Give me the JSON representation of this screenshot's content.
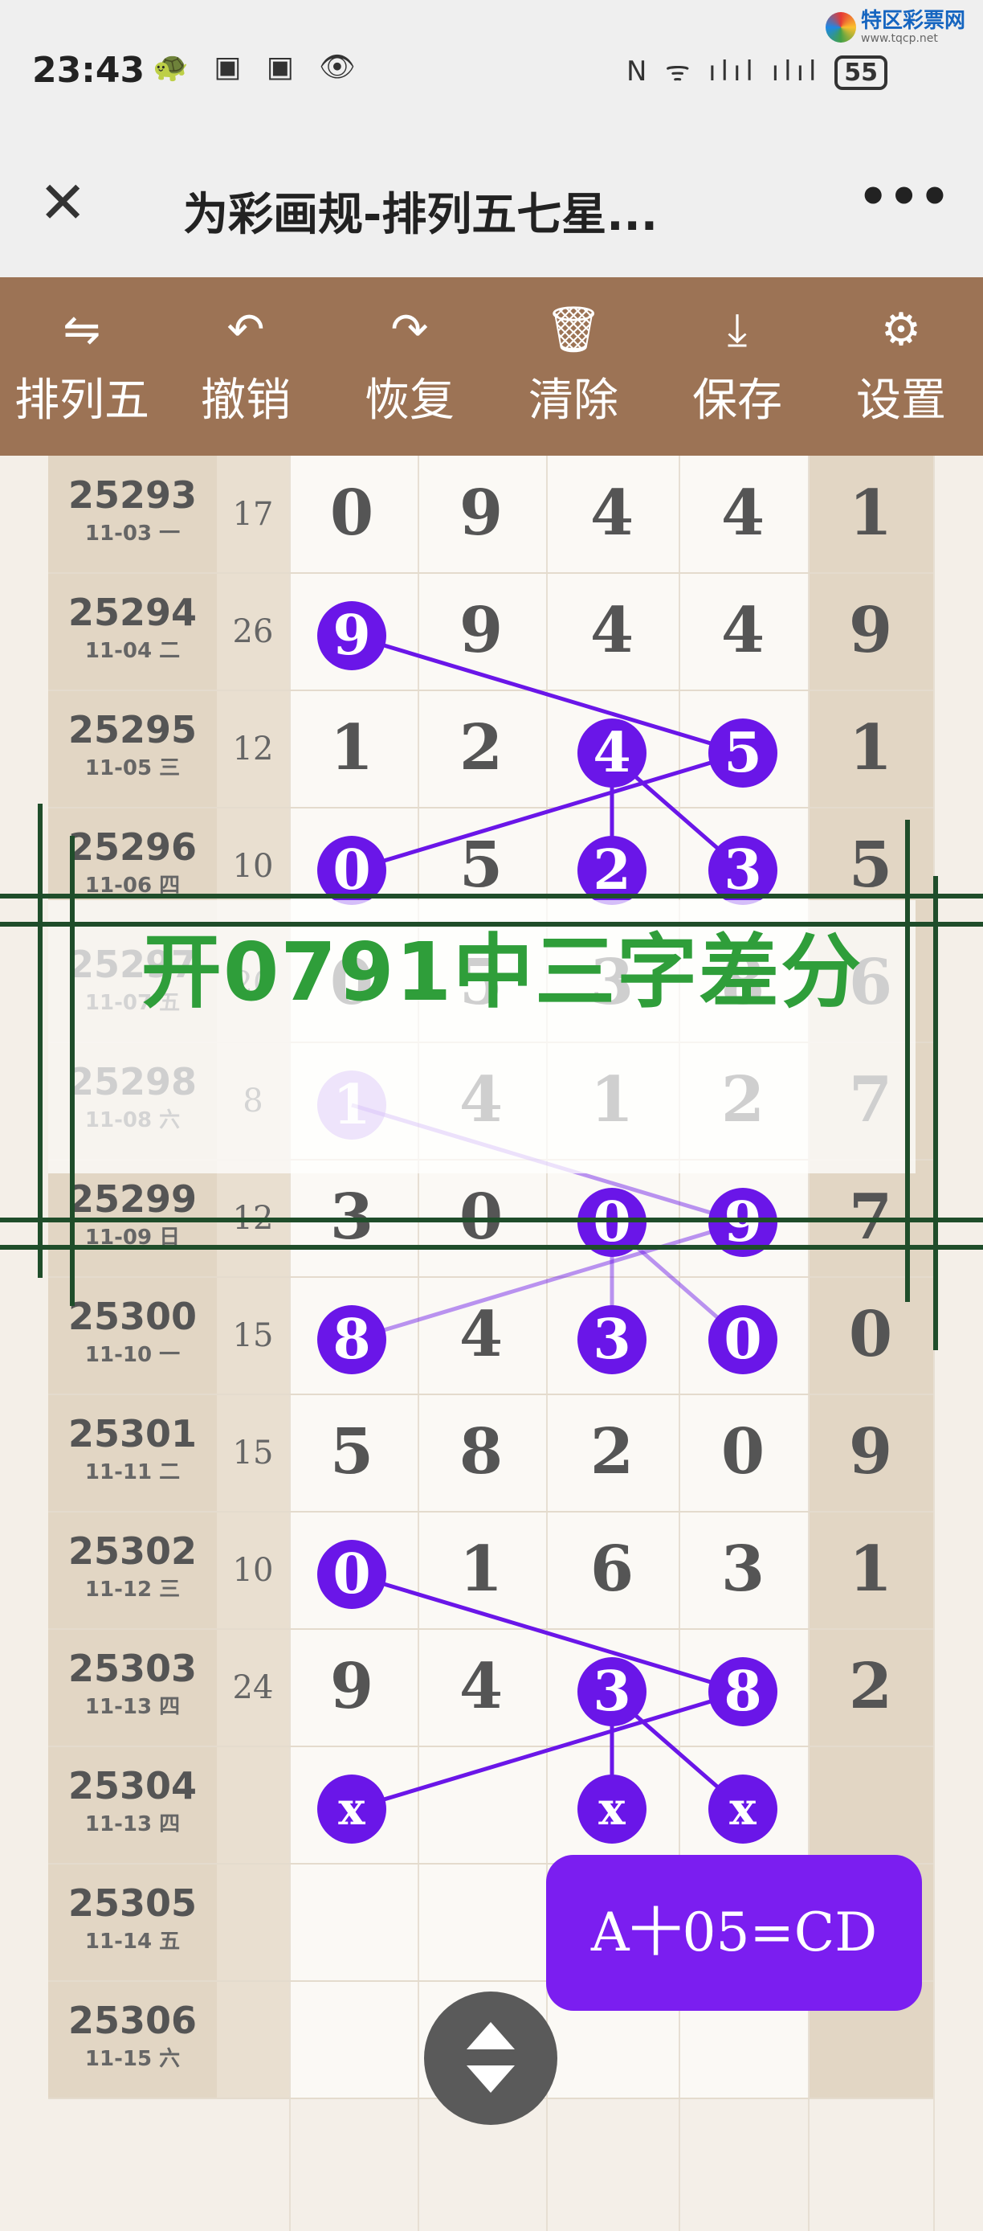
{
  "status": {
    "time": "23:43",
    "left_icons": "🐢 ▣ ▣ 👁",
    "right_icons": "N ᯤ ılıl ılıl",
    "battery": "55",
    "logo_text": "特区彩票网",
    "logo_url": "www.tqcp.net"
  },
  "titlebar": {
    "close_glyph": "✕",
    "title": "为彩画规-排列五七星...",
    "more_glyph": "•••"
  },
  "toolbar": [
    {
      "icon": "⇋",
      "label": "排列五"
    },
    {
      "icon": "↶",
      "label": "撤销"
    },
    {
      "icon": "↷",
      "label": "恢复"
    },
    {
      "icon": "🗑",
      "label": "清除"
    },
    {
      "icon": "⤓",
      "label": "保存"
    },
    {
      "icon": "⚙",
      "label": "设置"
    }
  ],
  "rows": [
    {
      "issue": "25293",
      "date": "11-03 一",
      "sum": "17",
      "digits": [
        "0",
        "9",
        "4",
        "4",
        "1"
      ],
      "circled": []
    },
    {
      "issue": "25294",
      "date": "11-04 二",
      "sum": "26",
      "digits": [
        "9",
        "9",
        "4",
        "4",
        "9"
      ],
      "circled": [
        0
      ]
    },
    {
      "issue": "25295",
      "date": "11-05 三",
      "sum": "12",
      "digits": [
        "1",
        "2",
        "4",
        "5",
        "1"
      ],
      "circled": [
        2,
        3
      ]
    },
    {
      "issue": "25296",
      "date": "11-06 四",
      "sum": "10",
      "digits": [
        "0",
        "5",
        "2",
        "3",
        "5"
      ],
      "circled": [
        0,
        2,
        3
      ]
    },
    {
      "issue": "25297",
      "date": "11-07 五",
      "sum": "20",
      "digits": [
        "0",
        "5",
        "3",
        "8",
        "6"
      ],
      "circled": []
    },
    {
      "issue": "25298",
      "date": "11-08 六",
      "sum": "8",
      "digits": [
        "1",
        "4",
        "1",
        "2",
        "7"
      ],
      "circled": [
        0
      ]
    },
    {
      "issue": "25299",
      "date": "11-09 日",
      "sum": "12",
      "digits": [
        "3",
        "0",
        "0",
        "9",
        "7"
      ],
      "circled": [
        2,
        3
      ]
    },
    {
      "issue": "25300",
      "date": "11-10 一",
      "sum": "15",
      "digits": [
        "8",
        "4",
        "3",
        "0",
        "0"
      ],
      "circled": [
        0,
        2,
        3
      ]
    },
    {
      "issue": "25301",
      "date": "11-11 二",
      "sum": "15",
      "digits": [
        "5",
        "8",
        "2",
        "0",
        "9"
      ],
      "circled": []
    },
    {
      "issue": "25302",
      "date": "11-12 三",
      "sum": "10",
      "digits": [
        "0",
        "1",
        "6",
        "3",
        "1"
      ],
      "circled": [
        0
      ]
    },
    {
      "issue": "25303",
      "date": "11-13 四",
      "sum": "24",
      "digits": [
        "9",
        "4",
        "3",
        "8",
        "2"
      ],
      "circled": [
        2,
        3
      ]
    },
    {
      "issue": "25304",
      "date": "11-13 四",
      "sum": "",
      "digits": [
        "x",
        "",
        "x",
        "x",
        ""
      ],
      "circled": [
        0,
        2,
        3
      ]
    },
    {
      "issue": "25305",
      "date": "11-14 五",
      "sum": "",
      "digits": [
        "",
        "",
        "",
        "",
        ""
      ],
      "circled": []
    },
    {
      "issue": "25306",
      "date": "11-15 六",
      "sum": "",
      "digits": [
        "",
        "",
        "",
        "",
        ""
      ],
      "circled": []
    }
  ],
  "banner_text": "开0791中三字差分",
  "formula": "A十05=CD",
  "colors": {
    "toolbar": "#9c7355",
    "circle": "#6a16e8",
    "banner_text": "#2f9e3a",
    "frame": "#1f4d2a"
  }
}
